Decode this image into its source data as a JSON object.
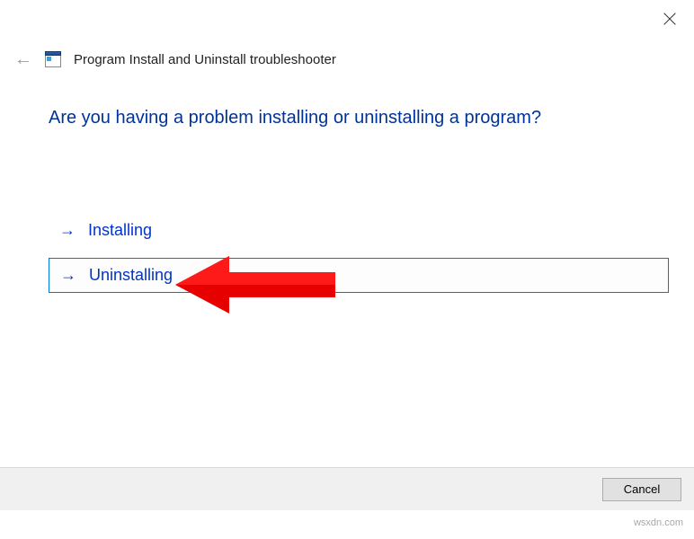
{
  "window": {
    "title": "Program Install and Uninstall troubleshooter"
  },
  "heading": "Are you having a problem installing or uninstalling a program?",
  "options": {
    "installing": "Installing",
    "uninstalling": "Uninstalling"
  },
  "footer": {
    "cancel": "Cancel"
  },
  "watermark": "wsxdn.com"
}
